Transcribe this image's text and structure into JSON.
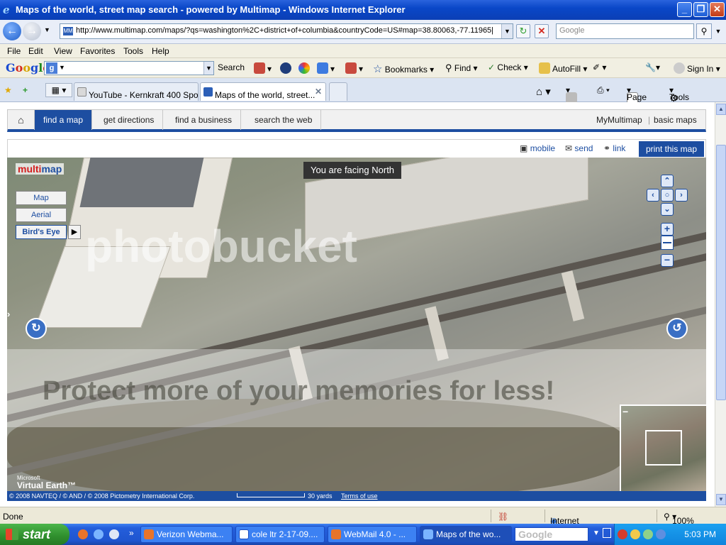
{
  "window": {
    "title": "Maps of the world, street map search - powered by Multimap - Windows Internet Explorer",
    "minimize_icon": "minimize-icon",
    "maximize_icon": "restore-icon",
    "close_icon": "close-icon"
  },
  "address_bar": {
    "url": "http://www.multimap.com/maps/?qs=washington%2C+district+of+columbia&countryCode=US#map=38.80063,-77.11965|",
    "search_placeholder": "Google"
  },
  "menu": [
    "File",
    "Edit",
    "View",
    "Favorites",
    "Tools",
    "Help"
  ],
  "google_toolbar": {
    "logo": [
      "G",
      "o",
      "o",
      "g",
      "l",
      "e"
    ],
    "search_label": "Search",
    "bookmarks": "Bookmarks",
    "find": "Find",
    "check": "Check",
    "autofill": "AutoFill",
    "signin": "Sign In"
  },
  "tabs": [
    {
      "label": "YouTube - Kernkraft 400 Spo...",
      "active": false
    },
    {
      "label": "Maps of the world, street...",
      "active": true
    }
  ],
  "command_bar": {
    "page": "Page",
    "tools": "Tools"
  },
  "site_nav": {
    "items": [
      "find a map",
      "get directions",
      "find a business",
      "search the web"
    ],
    "active_index": 0,
    "right": [
      "MyMultimap",
      "basic maps"
    ]
  },
  "map_tools": {
    "mobile": "mobile",
    "send": "send",
    "link": "link",
    "print": "print this map"
  },
  "map": {
    "logo": {
      "part1": "multi",
      "part2": "map"
    },
    "facing": "You are facing North",
    "types": [
      "Map",
      "Aerial",
      "Bird's Eye"
    ],
    "selected_type": "Bird's Eye",
    "watermark_brand": "photobucket",
    "watermark_text": "Protect more of your memories for less!",
    "ve_logo_small": "Microsoft",
    "ve_logo": "Virtual Earth™",
    "copyright": "© 2008 NAVTEQ / © AND / © 2008 Pictometry International Corp.",
    "scale_label": "30 yards",
    "terms": "Terms of use"
  },
  "status_bar": {
    "status": "Done",
    "zone": "Internet",
    "zoom": "100%"
  },
  "taskbar": {
    "start": "start",
    "tasks": [
      {
        "label": "Verizon Webma...",
        "active": false
      },
      {
        "label": "cole ltr 2-17-09....",
        "active": false
      },
      {
        "label": "WebMail 4.0 - ...",
        "active": false
      },
      {
        "label": "Maps of the wo...",
        "active": true
      }
    ],
    "desktop_search": "Google",
    "clock": "5:03 PM"
  }
}
